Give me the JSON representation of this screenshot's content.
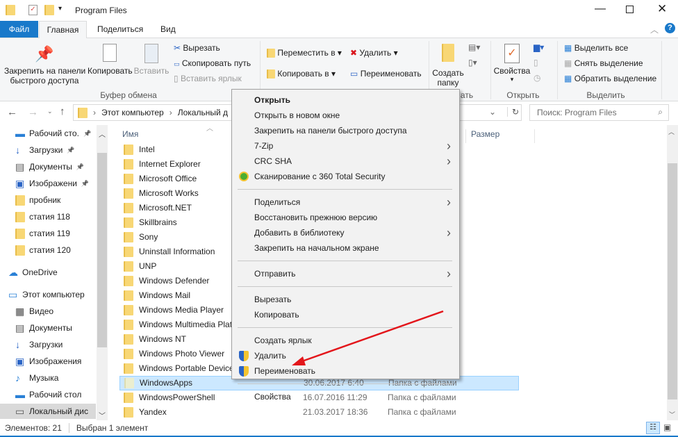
{
  "window": {
    "title": "Program Files"
  },
  "tabs": [
    {
      "label": "Файл"
    },
    {
      "label": "Главная"
    },
    {
      "label": "Поделиться"
    },
    {
      "label": "Вид"
    }
  ],
  "ribbon": {
    "pin": "Закрепить на панели\nбыстрого доступа",
    "pin1": "Закрепить на панели",
    "pin2": "быстрого доступа",
    "copy": "Копировать",
    "paste": "Вставить",
    "cut": "Вырезать",
    "copy_path": "Скопировать путь",
    "paste_shortcut": "Вставить ярлык",
    "clipboard_group": "Буфер обмена",
    "move_to": "Переместить в",
    "copy_to": "Копировать в",
    "delete": "Удалить",
    "rename": "Переименовать",
    "new_folder1": "Создать",
    "new_folder2": "папку",
    "create_group_tail": "ать",
    "properties": "Свойства",
    "open_group": "Открыть",
    "select_all": "Выделить все",
    "select_none": "Снять выделение",
    "invert": "Обратить выделение",
    "select_group": "Выделить"
  },
  "address": {
    "crumbs": [
      "Этот компьютер",
      "Локальный д"
    ],
    "search_placeholder": "Поиск: Program Files"
  },
  "columns": {
    "name": "Имя",
    "size": "Размер"
  },
  "nav": [
    {
      "label": "Рабочий сто.",
      "icon": "desktop-icon",
      "pinned": true
    },
    {
      "label": "Загрузки",
      "icon": "download-icon",
      "pinned": true
    },
    {
      "label": "Документы",
      "icon": "documents-icon",
      "pinned": true
    },
    {
      "label": "Изображени",
      "icon": "pictures-icon",
      "pinned": true
    },
    {
      "label": "пробник",
      "icon": "folder-icon"
    },
    {
      "label": "статия 118",
      "icon": "folder-icon"
    },
    {
      "label": "статия 119",
      "icon": "folder-icon"
    },
    {
      "label": "статия 120",
      "icon": "folder-icon"
    },
    {
      "label": "OneDrive",
      "icon": "cloud-icon"
    },
    {
      "label": "Этот компьютер",
      "icon": "computer-icon"
    },
    {
      "label": "Видео",
      "icon": "video-icon"
    },
    {
      "label": "Документы",
      "icon": "documents-icon"
    },
    {
      "label": "Загрузки",
      "icon": "download-icon"
    },
    {
      "label": "Изображения",
      "icon": "pictures-icon"
    },
    {
      "label": "Музыка",
      "icon": "music-icon"
    },
    {
      "label": "Рабочий стол",
      "icon": "desktop-icon"
    },
    {
      "label": "Локальный дис",
      "icon": "drive-icon"
    }
  ],
  "files": [
    {
      "name": "Intel"
    },
    {
      "name": "Internet Explorer"
    },
    {
      "name": "Microsoft Office"
    },
    {
      "name": "Microsoft Works"
    },
    {
      "name": "Microsoft.NET"
    },
    {
      "name": "Skillbrains"
    },
    {
      "name": "Sony"
    },
    {
      "name": "Uninstall Information"
    },
    {
      "name": "UNP"
    },
    {
      "name": "Windows Defender"
    },
    {
      "name": "Windows Mail"
    },
    {
      "name": "Windows Media Player"
    },
    {
      "name": "Windows Multimedia Platform"
    },
    {
      "name": "Windows NT"
    },
    {
      "name": "Windows Photo Viewer"
    },
    {
      "name": "Windows Portable Devices"
    },
    {
      "name": "WindowsApps",
      "date": "30.06.2017 6:40",
      "type": "Папка с файлами",
      "selected": true
    },
    {
      "name": "WindowsPowerShell",
      "date": "16.07.2016 11:29",
      "type": "Папка с файлами"
    },
    {
      "name": "Yandex",
      "date": "21.03.2017 18:36",
      "type": "Папка с файлами"
    }
  ],
  "menu": [
    {
      "label": "Открыть",
      "bold": true
    },
    {
      "label": "Открыть в новом окне"
    },
    {
      "label": "Закрепить на панели быстрого доступа"
    },
    {
      "label": "7-Zip",
      "sub": true
    },
    {
      "label": "CRC SHA",
      "sub": true
    },
    {
      "label": "Сканирование с 360 Total Security",
      "icon": "360-icon"
    },
    {
      "sep": true
    },
    {
      "label": "Поделиться",
      "sub": true
    },
    {
      "label": "Восстановить прежнюю версию"
    },
    {
      "label": "Добавить в библиотеку",
      "sub": true
    },
    {
      "label": "Закрепить на начальном экране"
    },
    {
      "sep": true
    },
    {
      "label": "Отправить",
      "sub": true
    },
    {
      "sep": true
    },
    {
      "label": "Вырезать"
    },
    {
      "label": "Копировать"
    },
    {
      "sep": true
    },
    {
      "label": "Создать ярлык"
    },
    {
      "label": "Удалить",
      "icon": "shield-icon"
    },
    {
      "label": "Переименовать",
      "icon": "shield-icon"
    },
    {
      "sep": true
    },
    {
      "label": "Свойства"
    }
  ],
  "status": {
    "count": "Элементов: 21",
    "selected": "Выбран 1 элемент"
  },
  "colors": {
    "accent": "#1979ca",
    "selection": "#cce8ff",
    "arrow": "#e3161b"
  }
}
